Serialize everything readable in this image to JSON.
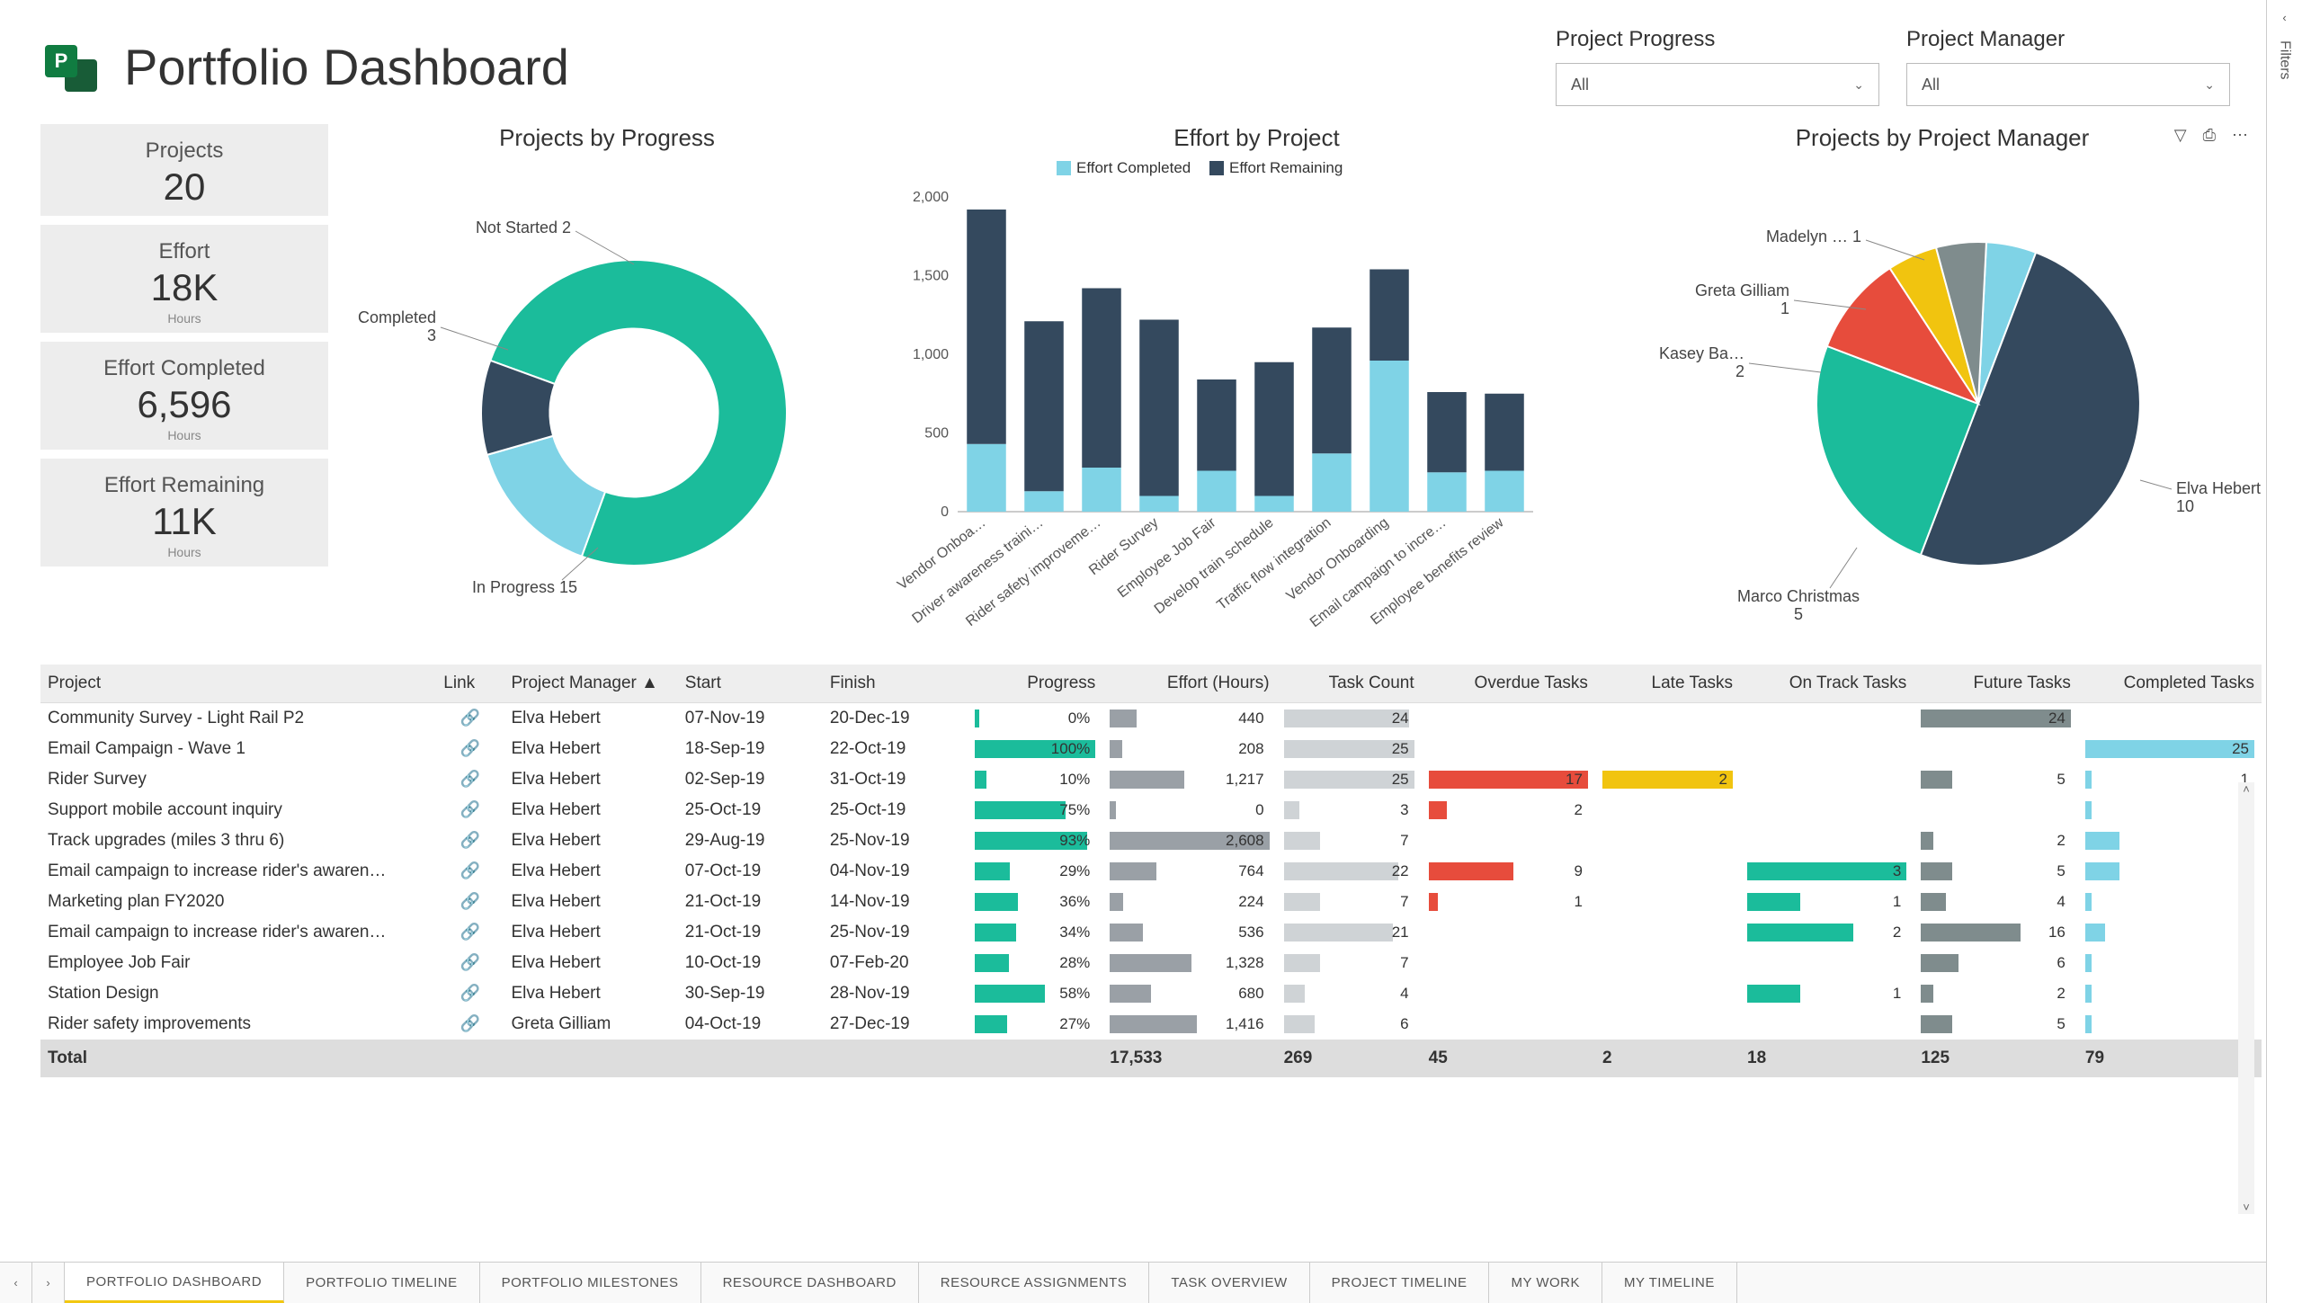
{
  "header": {
    "title": "Portfolio Dashboard",
    "logo_letter": "P"
  },
  "slicers": [
    {
      "label": "Project Progress",
      "value": "All"
    },
    {
      "label": "Project Manager",
      "value": "All"
    }
  ],
  "toolbar": {
    "filter_icon": "filter-icon",
    "pin_icon": "pin-icon",
    "more_icon": "more-icon"
  },
  "filters_panel": {
    "label": "Filters",
    "collapse_icon": "chevron-left-icon"
  },
  "kpis": [
    {
      "label": "Projects",
      "value": "20",
      "unit": ""
    },
    {
      "label": "Effort",
      "value": "18K",
      "unit": "Hours"
    },
    {
      "label": "Effort Completed",
      "value": "6,596",
      "unit": "Hours"
    },
    {
      "label": "Effort Remaining",
      "value": "11K",
      "unit": "Hours"
    }
  ],
  "chart_data": [
    {
      "id": "progress_donut",
      "type": "pie",
      "title": "Projects by Progress",
      "hole": 0.55,
      "series": [
        {
          "name": "In Progress",
          "value": 15,
          "color": "#1bbc9b"
        },
        {
          "name": "Completed",
          "value": 3,
          "color": "#7fd3e6"
        },
        {
          "name": "Not Started",
          "value": 2,
          "color": "#34495e"
        }
      ],
      "labels": [
        "In Progress 15",
        "Completed 3",
        "Not Started 2"
      ]
    },
    {
      "id": "effort_stack",
      "type": "bar",
      "stacked": true,
      "title": "Effort by Project",
      "ylabel": "",
      "ylim": [
        0,
        2000
      ],
      "yticks": [
        0,
        500,
        1000,
        1500,
        2000
      ],
      "legend": [
        "Effort Completed",
        "Effort Remaining"
      ],
      "colors": {
        "Effort Completed": "#7fd3e6",
        "Effort Remaining": "#34495e"
      },
      "categories": [
        "Vendor Onboa…",
        "Driver awareness traini…",
        "Rider safety improveme…",
        "Rider Survey",
        "Employee Job Fair",
        "Develop train schedule",
        "Traffic flow integration",
        "Vendor Onboarding",
        "Email campaign to incre…",
        "Employee benefits review"
      ],
      "series": [
        {
          "name": "Effort Completed",
          "values": [
            430,
            130,
            280,
            100,
            260,
            100,
            370,
            960,
            250,
            260
          ]
        },
        {
          "name": "Effort Remaining",
          "values": [
            1490,
            1080,
            1140,
            1120,
            580,
            850,
            800,
            580,
            510,
            490
          ]
        }
      ]
    },
    {
      "id": "pm_pie",
      "type": "pie",
      "title": "Projects by Project Manager",
      "hole": 0,
      "series": [
        {
          "name": "Elva Hebert",
          "value": 10,
          "color": "#34495e"
        },
        {
          "name": "Marco Christmas",
          "value": 5,
          "color": "#1bbc9b"
        },
        {
          "name": "Kasey Ba…",
          "value": 2,
          "color": "#e74c3c"
        },
        {
          "name": "Greta Gilliam",
          "value": 1,
          "color": "#f1c40f"
        },
        {
          "name": "Madelyn …",
          "value": 1,
          "color": "#7f8c8d"
        },
        {
          "name": "",
          "value": 1,
          "color": "#7fd3e6"
        }
      ]
    }
  ],
  "table": {
    "columns": [
      "Project",
      "Link",
      "Project Manager",
      "Start",
      "Finish",
      "Progress",
      "Effort (Hours)",
      "Task Count",
      "Overdue Tasks",
      "Late Tasks",
      "On Track Tasks",
      "Future Tasks",
      "Completed Tasks"
    ],
    "sort_col": "Project Manager",
    "rows": [
      {
        "project": "Community Survey - Light Rail P2",
        "pm": "Elva Hebert",
        "start": "07-Nov-19",
        "finish": "20-Dec-19",
        "progress": 0,
        "effort": 440,
        "tasks": 24,
        "overdue": null,
        "late": null,
        "ontrack": null,
        "future": 24,
        "completed": null
      },
      {
        "project": "Email Campaign - Wave 1",
        "pm": "Elva Hebert",
        "start": "18-Sep-19",
        "finish": "22-Oct-19",
        "progress": 100,
        "effort": 208,
        "tasks": 25,
        "overdue": null,
        "late": null,
        "ontrack": null,
        "future": null,
        "completed": 25
      },
      {
        "project": "Rider Survey",
        "pm": "Elva Hebert",
        "start": "02-Sep-19",
        "finish": "31-Oct-19",
        "progress": 10,
        "effort": 1217,
        "tasks": 25,
        "overdue": 17,
        "late": 2,
        "ontrack": null,
        "future": 5,
        "completed": 1
      },
      {
        "project": "Support mobile account inquiry",
        "pm": "Elva Hebert",
        "start": "25-Oct-19",
        "finish": "25-Oct-19",
        "progress": 75,
        "effort": 0,
        "tasks": 3,
        "overdue": 2,
        "late": null,
        "ontrack": null,
        "future": null,
        "completed": 1
      },
      {
        "project": "Track upgrades (miles 3 thru 6)",
        "pm": "Elva Hebert",
        "start": "29-Aug-19",
        "finish": "25-Nov-19",
        "progress": 93,
        "effort": 2608,
        "tasks": 7,
        "overdue": null,
        "late": null,
        "ontrack": null,
        "future": 2,
        "completed": 5
      },
      {
        "project": "Email campaign to increase rider's awaren…",
        "pm": "Elva Hebert",
        "start": "07-Oct-19",
        "finish": "04-Nov-19",
        "progress": 29,
        "effort": 764,
        "tasks": 22,
        "overdue": 9,
        "late": null,
        "ontrack": 3,
        "future": 5,
        "completed": 5
      },
      {
        "project": "Marketing plan FY2020",
        "pm": "Elva Hebert",
        "start": "21-Oct-19",
        "finish": "14-Nov-19",
        "progress": 36,
        "effort": 224,
        "tasks": 7,
        "overdue": 1,
        "late": null,
        "ontrack": 1,
        "future": 4,
        "completed": 1
      },
      {
        "project": "Email campaign to increase rider's awaren…",
        "pm": "Elva Hebert",
        "start": "21-Oct-19",
        "finish": "25-Nov-19",
        "progress": 34,
        "effort": 536,
        "tasks": 21,
        "overdue": null,
        "late": null,
        "ontrack": 2,
        "future": 16,
        "completed": 3
      },
      {
        "project": "Employee Job Fair",
        "pm": "Elva Hebert",
        "start": "10-Oct-19",
        "finish": "07-Feb-20",
        "progress": 28,
        "effort": 1328,
        "tasks": 7,
        "overdue": null,
        "late": null,
        "ontrack": null,
        "future": 6,
        "completed": 1
      },
      {
        "project": "Station Design",
        "pm": "Elva Hebert",
        "start": "30-Sep-19",
        "finish": "28-Nov-19",
        "progress": 58,
        "effort": 680,
        "tasks": 4,
        "overdue": null,
        "late": null,
        "ontrack": 1,
        "future": 2,
        "completed": 1
      },
      {
        "project": "Rider safety improvements",
        "pm": "Greta Gilliam",
        "start": "04-Oct-19",
        "finish": "27-Dec-19",
        "progress": 27,
        "effort": 1416,
        "tasks": 6,
        "overdue": null,
        "late": null,
        "ontrack": null,
        "future": 5,
        "completed": 1
      }
    ],
    "totals": {
      "label": "Total",
      "effort": "17,533",
      "tasks": 269,
      "overdue": 45,
      "late": 2,
      "ontrack": 18,
      "future": 125,
      "completed": 79
    },
    "bar_colors": {
      "progress": "#1bbc9b",
      "effort": "#9aa0a6",
      "tasks": "#cfd3d6",
      "overdue": "#e74c3c",
      "late": "#f1c40f",
      "ontrack": "#1bbc9b",
      "future": "#7f8c8d",
      "completed": "#7fd3e6"
    },
    "max": {
      "progress": 100,
      "effort": 2608,
      "tasks": 25,
      "overdue": 17,
      "late": 2,
      "ontrack": 3,
      "future": 24,
      "completed": 25
    }
  },
  "tabs": {
    "items": [
      "PORTFOLIO DASHBOARD",
      "PORTFOLIO TIMELINE",
      "PORTFOLIO MILESTONES",
      "RESOURCE DASHBOARD",
      "RESOURCE ASSIGNMENTS",
      "TASK OVERVIEW",
      "PROJECT TIMELINE",
      "MY WORK",
      "MY TIMELINE"
    ],
    "active": 0
  }
}
